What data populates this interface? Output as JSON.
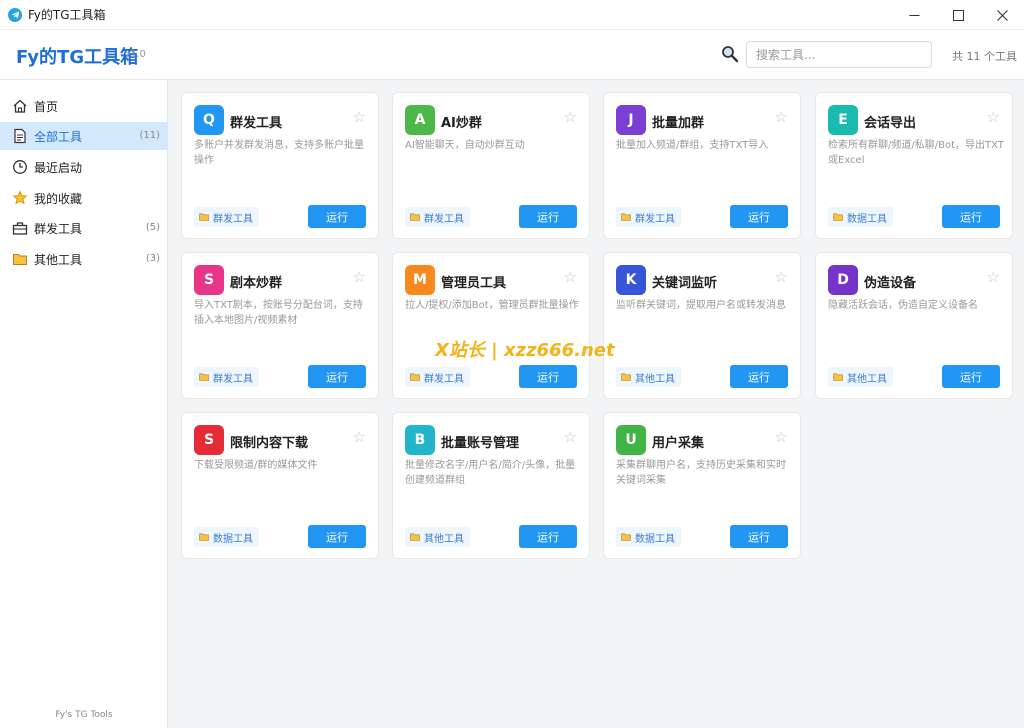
{
  "window": {
    "title": "Fy的TG工具箱",
    "minimize": "—",
    "maximize": "☐",
    "close": "✕"
  },
  "header": {
    "title": "Fy的TG工具箱",
    "version": "v1.0",
    "search_placeholder": "搜索工具...",
    "tool_count": "共 11 个工具"
  },
  "sidebar": {
    "items": [
      {
        "label": "首页",
        "count": "",
        "icon": "home-icon"
      },
      {
        "label": "全部工具",
        "count": "(11)",
        "icon": "document-icon",
        "active": true
      },
      {
        "label": "最近启动",
        "count": "",
        "icon": "clock-icon"
      },
      {
        "label": "我的收藏",
        "count": "",
        "icon": "star-icon"
      },
      {
        "label": "群发工具",
        "count": "(5)",
        "icon": "toolbox-icon"
      },
      {
        "label": "其他工具",
        "count": "(3)",
        "icon": "folder-icon"
      }
    ],
    "footer": "Fy's TG Tools"
  },
  "run_label": "运行",
  "star_glyph": "☆",
  "cards": [
    {
      "letter": "Q",
      "title": "群发工具",
      "desc": "多账户并发群发消息，支持多账户批量操作",
      "tag": "群发工具",
      "color": "#2196f3"
    },
    {
      "letter": "A",
      "title": "AI炒群",
      "desc": "AI智能聊天，自动炒群互动",
      "tag": "群发工具",
      "color": "#4cb848"
    },
    {
      "letter": "J",
      "title": "批量加群",
      "desc": "批量加入频道/群组，支持TXT导入",
      "tag": "群发工具",
      "color": "#7b3fd3"
    },
    {
      "letter": "E",
      "title": "会话导出",
      "desc": "检索所有群聊/频道/私聊/Bot，导出TXT或Excel",
      "tag": "数据工具",
      "color": "#1bbab1"
    },
    {
      "letter": "S",
      "title": "剧本炒群",
      "desc": "导入TXT剧本，按账号分配台词，支持插入本地图片/视频素材",
      "tag": "群发工具",
      "color": "#e8358a"
    },
    {
      "letter": "M",
      "title": "管理员工具",
      "desc": "拉人/提权/添加Bot，管理员群批量操作",
      "tag": "群发工具",
      "color": "#f5891f"
    },
    {
      "letter": "K",
      "title": "关键词监听",
      "desc": "监听群关键词，提取用户名或转发消息",
      "tag": "其他工具",
      "color": "#3655d9"
    },
    {
      "letter": "D",
      "title": "伪造设备",
      "desc": "隐藏活跃会话，伪造自定义设备名",
      "tag": "其他工具",
      "color": "#7534c9"
    },
    {
      "letter": "S",
      "title": "限制内容下载",
      "desc": "下载受限频道/群的媒体文件",
      "tag": "数据工具",
      "color": "#e52b35"
    },
    {
      "letter": "B",
      "title": "批量账号管理",
      "desc": "批量修改名字/用户名/简介/头像，批量创建频道群组",
      "tag": "其他工具",
      "color": "#22b5c9"
    },
    {
      "letter": "U",
      "title": "用户采集",
      "desc": "采集群聊用户名，支持历史采集和实时关键词采集",
      "tag": "数据工具",
      "color": "#40b545"
    }
  ],
  "watermark": "X站长 | xzz666.net"
}
